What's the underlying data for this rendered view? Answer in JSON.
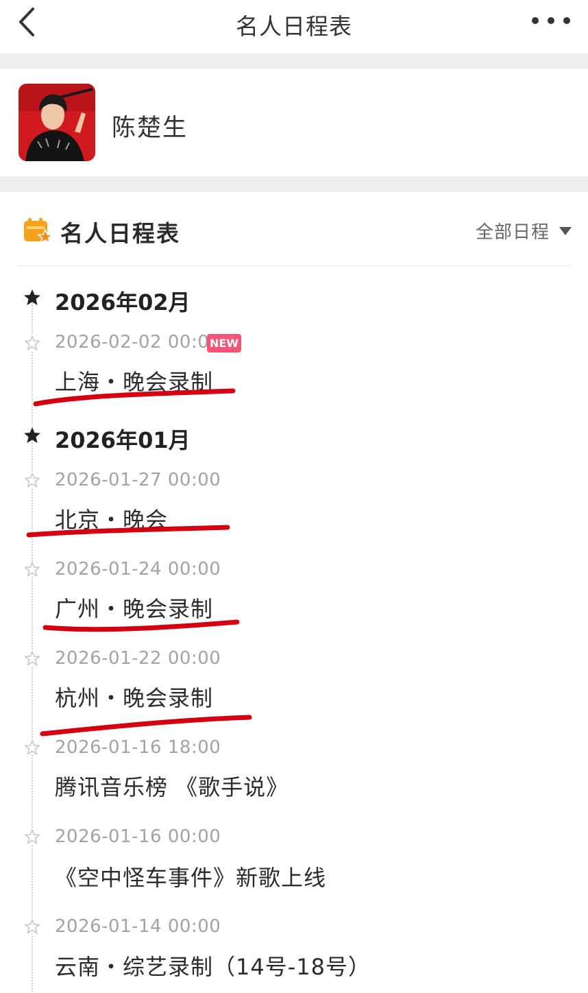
{
  "navbar": {
    "title": "名人日程表",
    "back_icon": "chevron-left-icon",
    "more_icon": "more-horizontal-icon"
  },
  "profile": {
    "name": "陈楚生",
    "avatar": "avatar-photo"
  },
  "schedule": {
    "icon": "calendar-star-icon",
    "title": "名人日程表",
    "filter_label": "全部日程",
    "months": [
      {
        "label": "2026年02月",
        "entries": [
          {
            "time": "2026-02-02 00:00",
            "title": "上海・晚会录制",
            "badge": "NEW",
            "underlined": true
          }
        ]
      },
      {
        "label": "2026年01月",
        "entries": [
          {
            "time": "2026-01-27 00:00",
            "title": "北京・晚会",
            "underlined": true
          },
          {
            "time": "2026-01-24 00:00",
            "title": "广州・晚会录制",
            "underlined": true
          },
          {
            "time": "2026-01-22 00:00",
            "title": "杭州・晚会录制",
            "underlined": true
          },
          {
            "time": "2026-01-16 18:00",
            "title": "腾讯音乐榜 《歌手说》",
            "underlined": false
          },
          {
            "time": "2026-01-16 00:00",
            "title": "《空中怪车事件》新歌上线",
            "underlined": false
          },
          {
            "time": "2026-01-14 00:00",
            "title": "云南・综艺录制（14号-18号）",
            "underlined": false
          }
        ]
      }
    ]
  },
  "colors": {
    "badge_bg": "#f45577",
    "underline_marker": "#d40012",
    "icon_orange": "#f7a21b",
    "page_gap": "#efefef"
  }
}
